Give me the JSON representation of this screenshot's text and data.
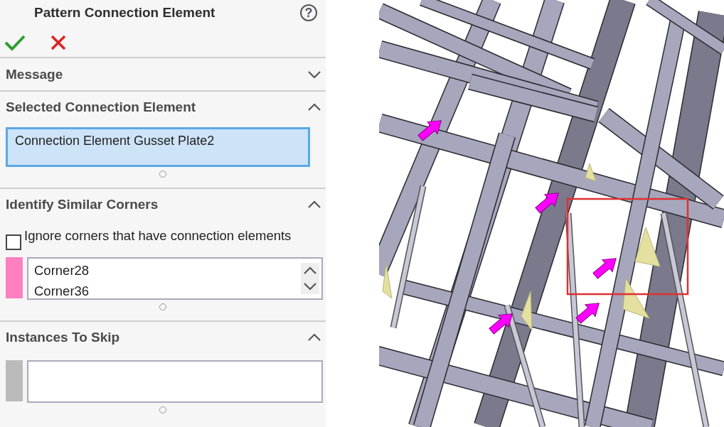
{
  "panel": {
    "title": "Pattern Connection Element",
    "help": "?",
    "sections": [
      {
        "kind": "message",
        "title": "Message",
        "expanded": false
      },
      {
        "kind": "selection",
        "title": "Selected Connection Element",
        "expanded": true,
        "field": {
          "value": "Connection Element Gusset Plate2",
          "selected": true
        }
      },
      {
        "kind": "corners",
        "title": "Identify Similar Corners",
        "expanded": true,
        "checkbox": {
          "label": "Ignore corners that have connection elements",
          "checked": false
        },
        "list": {
          "color": "#ff80c0",
          "items": [
            "Corner28",
            "Corner36"
          ]
        }
      },
      {
        "kind": "skip",
        "title": "Instances To Skip",
        "expanded": true,
        "list": {
          "color": "#bbbbbb"
        }
      }
    ]
  }
}
